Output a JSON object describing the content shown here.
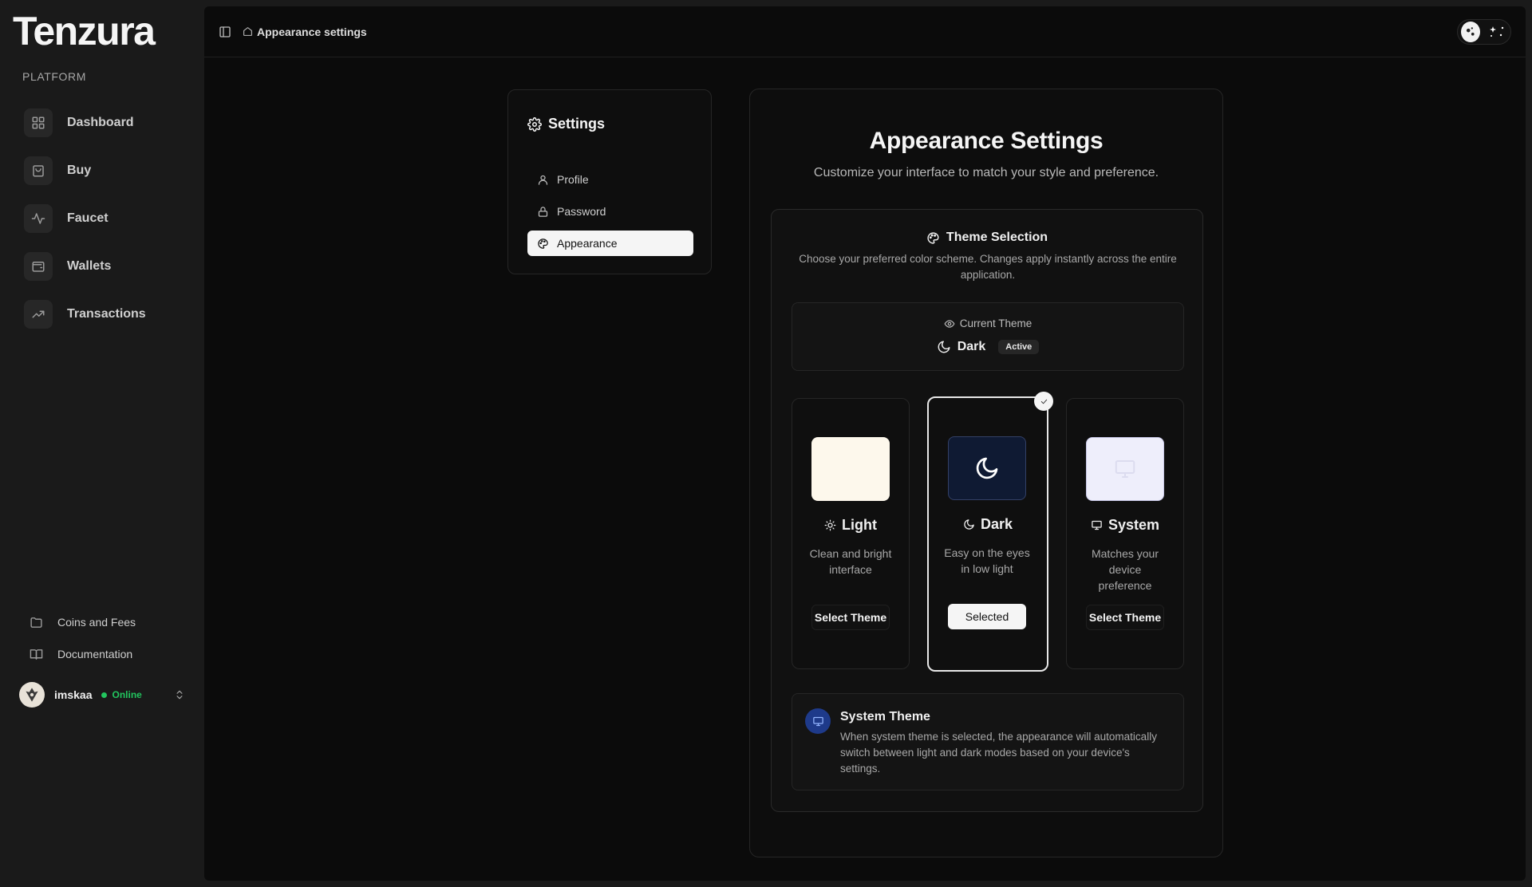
{
  "app": {
    "logo": "Tenzura",
    "section": "PLATFORM"
  },
  "sidebar": {
    "items": [
      {
        "label": "Dashboard",
        "icon": "grid-icon"
      },
      {
        "label": "Buy",
        "icon": "shopping-bag-icon"
      },
      {
        "label": "Faucet",
        "icon": "activity-icon"
      },
      {
        "label": "Wallets",
        "icon": "wallet-icon"
      },
      {
        "label": "Transactions",
        "icon": "trending-up-icon"
      }
    ],
    "footer": [
      {
        "label": "Coins and Fees",
        "icon": "folder-icon"
      },
      {
        "label": "Documentation",
        "icon": "book-icon"
      }
    ],
    "user": {
      "name": "imskaa",
      "status": "Online"
    }
  },
  "topbar": {
    "breadcrumb": "Appearance settings"
  },
  "settings_nav": {
    "title": "Settings",
    "items": [
      {
        "label": "Profile",
        "icon": "user-icon",
        "active": false
      },
      {
        "label": "Password",
        "icon": "lock-icon",
        "active": false
      },
      {
        "label": "Appearance",
        "icon": "palette-icon",
        "active": true
      }
    ]
  },
  "appearance": {
    "title": "Appearance Settings",
    "subtitle": "Customize your interface to match your style and preference.",
    "theme_selection": {
      "title": "Theme Selection",
      "description": "Choose your preferred color scheme. Changes apply instantly across the entire application."
    },
    "current": {
      "label": "Current Theme",
      "value": "Dark",
      "badge": "Active"
    },
    "options": [
      {
        "name": "Light",
        "description": "Clean and bright interface",
        "button": "Select Theme",
        "selected": false,
        "swatch_color": "#fdf8ec"
      },
      {
        "name": "Dark",
        "description": "Easy on the eyes in low light",
        "button": "Selected",
        "selected": true,
        "swatch_color": "#0f1a33"
      },
      {
        "name": "System",
        "description": "Matches your device preference",
        "button": "Select Theme",
        "selected": false,
        "swatch_color": "#eeeefb"
      }
    ],
    "system_info": {
      "title": "System Theme",
      "description": "When system theme is selected, the appearance will automatically switch between light and dark modes based on your device's settings."
    }
  },
  "colors": {
    "accent_status": "#22c55e",
    "system_icon_bg": "#1e3a8a"
  }
}
